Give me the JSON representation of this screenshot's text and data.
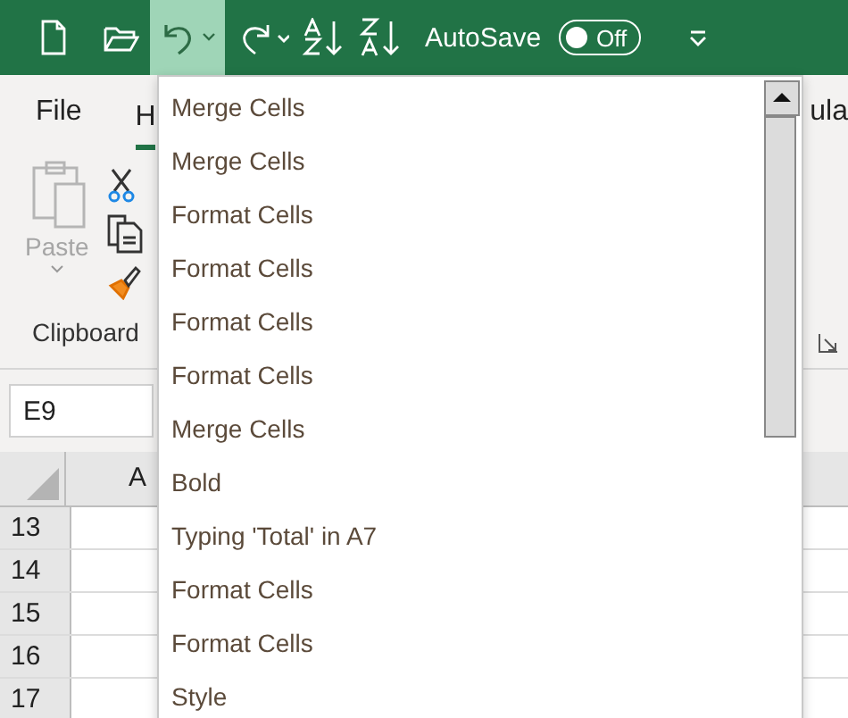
{
  "toolbar": {
    "undo_selected": true,
    "autosave": {
      "label": "AutoSave",
      "on": false,
      "state_text": "Off"
    }
  },
  "tabs": [
    {
      "label": "File",
      "selected": false
    },
    {
      "label": "H",
      "selected": true
    },
    {
      "label": "ula",
      "selected": false
    }
  ],
  "clipboard": {
    "paste_label": "Paste",
    "paste_disabled": true,
    "group_label": "Clipboard"
  },
  "name_box": "E9",
  "columns": [
    "A"
  ],
  "rows": [
    "13",
    "14",
    "15",
    "16",
    "17"
  ],
  "undo_list": [
    "Merge Cells",
    "Merge Cells",
    "Format Cells",
    "Format Cells",
    "Format Cells",
    "Format Cells",
    "Merge Cells",
    "Bold",
    "Typing 'Total' in A7",
    "Format Cells",
    "Format Cells",
    "Style"
  ]
}
